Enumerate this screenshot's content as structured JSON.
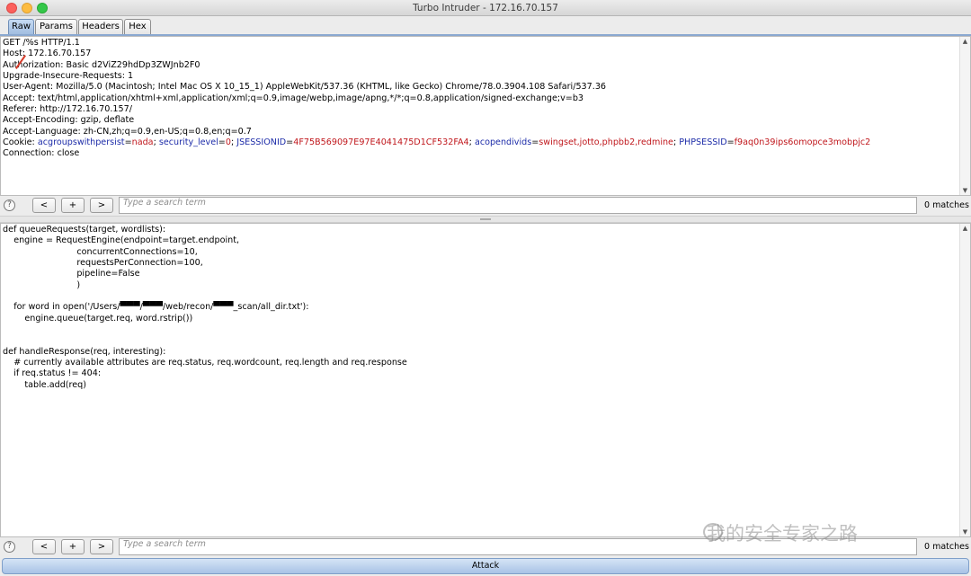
{
  "window": {
    "title": "Turbo Intruder - 172.16.70.157"
  },
  "tabs": [
    "Raw",
    "Params",
    "Headers",
    "Hex"
  ],
  "request": {
    "lines": [
      "GET /%s HTTP/1.1",
      "Host: 172.16.70.157",
      "Authorization: Basic d2ViZ29hdDp3ZWJnb2F0",
      "Upgrade-Insecure-Requests: 1",
      "User-Agent: Mozilla/5.0 (Macintosh; Intel Mac OS X 10_15_1) AppleWebKit/537.36 (KHTML, like Gecko) Chrome/78.0.3904.108 Safari/537.36",
      "Accept: text/html,application/xhtml+xml,application/xml;q=0.9,image/webp,image/apng,*/*;q=0.8,application/signed-exchange;v=b3",
      "Referer: http://172.16.70.157/",
      "Accept-Encoding: gzip, deflate",
      "Accept-Language: zh-CN,zh;q=0.9,en-US;q=0.8,en;q=0.7"
    ],
    "cookie_label": "Cookie: ",
    "cookies": [
      {
        "name": "acgroupswithpersist",
        "value": "nada"
      },
      {
        "name": "security_level",
        "value": "0"
      },
      {
        "name": "JSESSIONID",
        "value": "4F75B569097E97E4041475D1CF532FA4"
      },
      {
        "name": "acopendivids",
        "value": "swingset,jotto,phpbb2,redmine"
      },
      {
        "name": "PHPSESSID",
        "value": "f9aq0n39ips6omopce3mobpjc2"
      }
    ],
    "connection_line": "Connection: close"
  },
  "script": {
    "lines": [
      "def queueRequests(target, wordlists):",
      "    engine = RequestEngine(endpoint=target.endpoint,",
      "                           concurrentConnections=10,",
      "                           requestsPerConnection=100,",
      "                           pipeline=False",
      "                           )",
      "",
      "    for word in open('/Users/▀▀▀/▀▀▀/web/recon/▀▀▀_scan/all_dir.txt'):",
      "        engine.queue(target.req, word.rstrip())",
      "",
      "",
      "def handleResponse(req, interesting):",
      "    # currently available attributes are req.status, req.wordcount, req.length and req.response",
      "    if req.status != 404:",
      "        table.add(req)"
    ]
  },
  "search": {
    "help_label": "?",
    "prev_label": "<",
    "add_label": "+",
    "next_label": ">",
    "placeholder": "Type a search term",
    "matches_top": "0 matches",
    "matches_bottom": "0 matches"
  },
  "attack_button": {
    "label": "Attack"
  },
  "watermark": {
    "text": "我的安全专家之路"
  },
  "colors": {
    "cookie_name": "#1c2ba8",
    "cookie_value": "#c0171c",
    "accent": "#a8c3e6"
  }
}
